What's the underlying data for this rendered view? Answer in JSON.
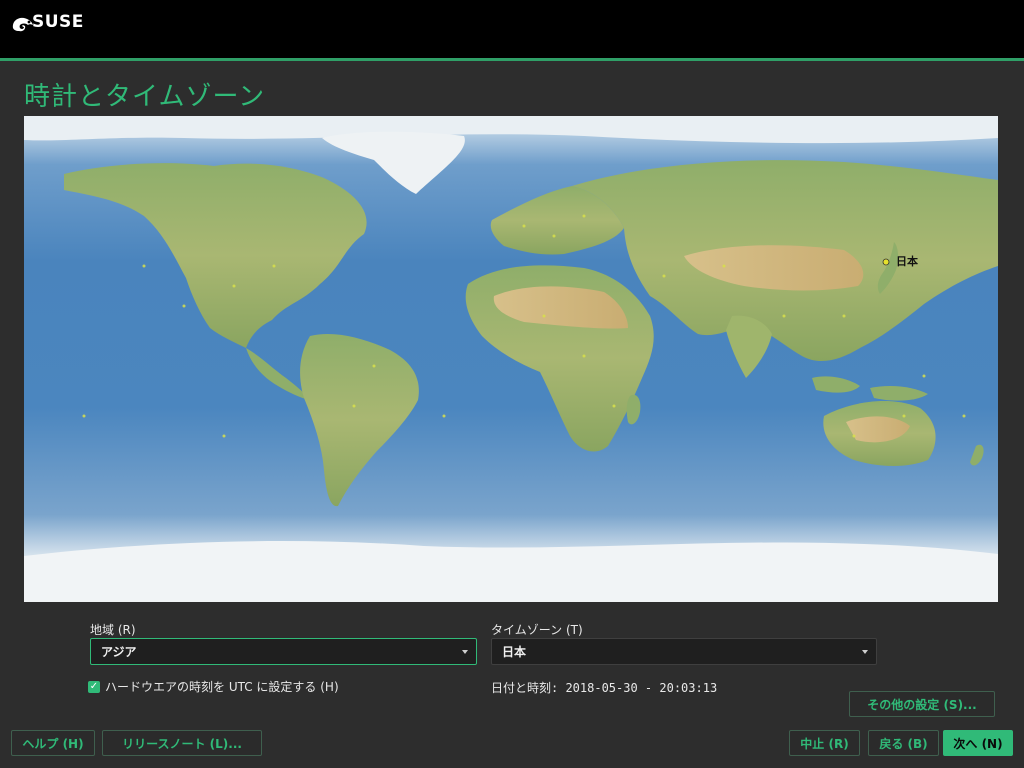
{
  "header": {
    "logo_text": "SUSE",
    "logo_icon": "chameleon-icon",
    "accent_color": "#30ba78"
  },
  "page": {
    "title": "時計とタイムゾーン"
  },
  "map": {
    "selected_city_label": "日本"
  },
  "region": {
    "label": "地域 (R)",
    "value": "アジア"
  },
  "timezone": {
    "label": "タイムゾーン (T)",
    "value": "日本"
  },
  "hardware_clock": {
    "label": "ハードウエアの時刻を UTC に設定する (H)",
    "checked": true
  },
  "datetime": {
    "text": "日付と時刻: 2018-05-30 - 20:03:13"
  },
  "buttons": {
    "other_settings": "その他の設定 (S)...",
    "help": "ヘルプ (H)",
    "release_notes": "リリースノート (L)...",
    "abort": "中止 (R)",
    "back": "戻る (B)",
    "next": "次へ (N)"
  }
}
